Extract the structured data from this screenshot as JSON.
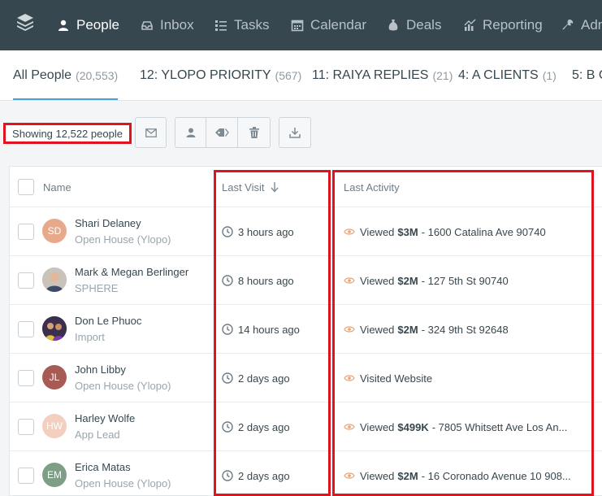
{
  "nav": {
    "items": [
      {
        "label": "People",
        "icon": "person-icon",
        "active": true
      },
      {
        "label": "Inbox",
        "icon": "inbox-icon",
        "active": false
      },
      {
        "label": "Tasks",
        "icon": "tasks-list-icon",
        "active": false
      },
      {
        "label": "Calendar",
        "icon": "calendar-icon",
        "active": false
      },
      {
        "label": "Deals",
        "icon": "money-bag-icon",
        "active": false
      },
      {
        "label": "Reporting",
        "icon": "chart-icon",
        "active": false
      },
      {
        "label": "Admin",
        "icon": "wrench-icon",
        "active": false
      }
    ]
  },
  "tabs": [
    {
      "label": "All People",
      "count": "(20,553)",
      "active": true
    },
    {
      "label": "12: YLOPO PRIORITY",
      "count": "(567)",
      "active": false
    },
    {
      "label": "11: RAIYA REPLIES",
      "count": "(21)",
      "active": false
    },
    {
      "label": "4: A CLIENTS",
      "count": "(1)",
      "active": false
    },
    {
      "label": "5: B C",
      "count": "",
      "active": false
    }
  ],
  "toolbar": {
    "showing": "Showing 12,522 people",
    "buttons": [
      "email-icon",
      "assign-person-icon",
      "tag-icon",
      "trash-icon",
      "download-icon"
    ]
  },
  "table": {
    "headers": {
      "name": "Name",
      "last_visit": "Last Visit",
      "last_activity": "Last Activity"
    },
    "rows": [
      {
        "name": "Shari Delaney",
        "source": "Open House (Ylopo)",
        "initials": "SD",
        "avatar_color": "#e8a98a",
        "photo": false,
        "last_visit": "3 hours ago",
        "activity_verb": "Viewed",
        "activity_price": "$3M",
        "activity_detail": "- 1600 Catalina Ave 90740"
      },
      {
        "name": "Mark & Megan Berlinger",
        "source": "SPHERE",
        "initials": "",
        "avatar_color": "#c9b8a8",
        "photo": true,
        "last_visit": "8 hours ago",
        "activity_verb": "Viewed",
        "activity_price": "$2M",
        "activity_detail": "- 127 5th St 90740"
      },
      {
        "name": "Don Le Phuoc",
        "source": "Import",
        "initials": "",
        "avatar_color": "#4a3a5a",
        "photo": true,
        "last_visit": "14 hours ago",
        "activity_verb": "Viewed",
        "activity_price": "$2M",
        "activity_detail": "- 324 9th St 92648"
      },
      {
        "name": "John Libby",
        "source": "Open House (Ylopo)",
        "initials": "JL",
        "avatar_color": "#a85a55",
        "photo": false,
        "last_visit": "2 days ago",
        "activity_verb": "Visited Website",
        "activity_price": "",
        "activity_detail": ""
      },
      {
        "name": "Harley Wolfe",
        "source": "App Lead",
        "initials": "HW",
        "avatar_color": "#f3cfc0",
        "photo": false,
        "last_visit": "2 days ago",
        "activity_verb": "Viewed",
        "activity_price": "$499K",
        "activity_detail": "- 7805 Whitsett Ave Los An..."
      },
      {
        "name": "Erica Matas",
        "source": "Open House (Ylopo)",
        "initials": "EM",
        "avatar_color": "#7e9e86",
        "photo": false,
        "last_visit": "2 days ago",
        "activity_verb": "Viewed",
        "activity_price": "$2M",
        "activity_detail": "- 16 Coronado Avenue 10 908..."
      }
    ]
  },
  "colors": {
    "nav_bg": "#37474f",
    "accent": "#47a1d8",
    "highlight": "#e0141e",
    "activity_eye": "#e8a070"
  }
}
